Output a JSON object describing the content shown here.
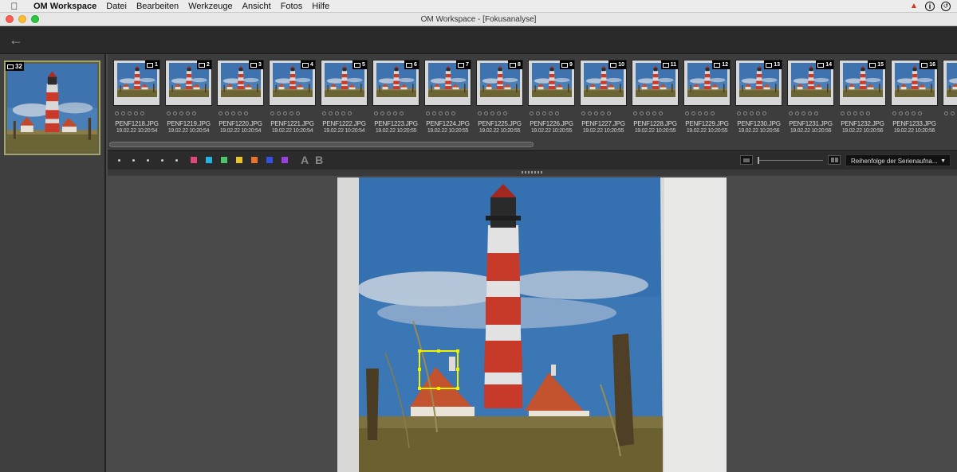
{
  "menubar": {
    "apple_icon": "apple-icon",
    "items": [
      "OM Workspace",
      "Datei",
      "Bearbeiten",
      "Werkzeuge",
      "Ansicht",
      "Fotos",
      "Hilfe"
    ]
  },
  "window": {
    "title": "OM Workspace - [Fokusanalyse]"
  },
  "toolbar": {
    "back_icon": "←"
  },
  "group": {
    "count": "32"
  },
  "filmstrip": {
    "frames": [
      {
        "index": "1",
        "filename": "PENF1218.JPG",
        "date": "19.02.22 10:20:54"
      },
      {
        "index": "2",
        "filename": "PENF1219.JPG",
        "date": "19.02.22 10:20:54"
      },
      {
        "index": "3",
        "filename": "PENF1220.JPG",
        "date": "19.02.22 10:20:54"
      },
      {
        "index": "4",
        "filename": "PENF1221.JPG",
        "date": "19.02.22 10:20:54"
      },
      {
        "index": "5",
        "filename": "PENF1222.JPG",
        "date": "19.02.22 10:20:54"
      },
      {
        "index": "6",
        "filename": "PENF1223.JPG",
        "date": "19.02.22 10:20:55"
      },
      {
        "index": "7",
        "filename": "PENF1224.JPG",
        "date": "19.02.22 10:20:55"
      },
      {
        "index": "8",
        "filename": "PENF1225.JPG",
        "date": "19.02.22 10:20:55"
      },
      {
        "index": "9",
        "filename": "PENF1226.JPG",
        "date": "19.02.22 10:20:55"
      },
      {
        "index": "10",
        "filename": "PENF1227.JPG",
        "date": "19.02.22 10:20:55"
      },
      {
        "index": "11",
        "filename": "PENF1228.JPG",
        "date": "19.02.22 10:20:55"
      },
      {
        "index": "12",
        "filename": "PENF1229.JPG",
        "date": "19.02.22 10:20:55"
      },
      {
        "index": "13",
        "filename": "PENF1230.JPG",
        "date": "19.02.22 10:20:56"
      },
      {
        "index": "14",
        "filename": "PENF1231.JPG",
        "date": "19.02.22 10:20:56"
      },
      {
        "index": "15",
        "filename": "PENF1232.JPG",
        "date": "19.02.22 10:20:56"
      },
      {
        "index": "16",
        "filename": "PENF1233.JPG",
        "date": "19.02.22 10:20:56"
      },
      {
        "index": "",
        "filename": "PENF",
        "date": "19.0"
      }
    ]
  },
  "filterbar": {
    "color_labels": [
      "#e0457b",
      "#27b3e0",
      "#4bc46a",
      "#e8c22a",
      "#e8742a",
      "#3550e0",
      "#9b3fe0"
    ],
    "label_a": "A",
    "label_b": "B",
    "sort_label": "Reihenfolge der Serienaufna...",
    "sort_caret": "▼"
  }
}
